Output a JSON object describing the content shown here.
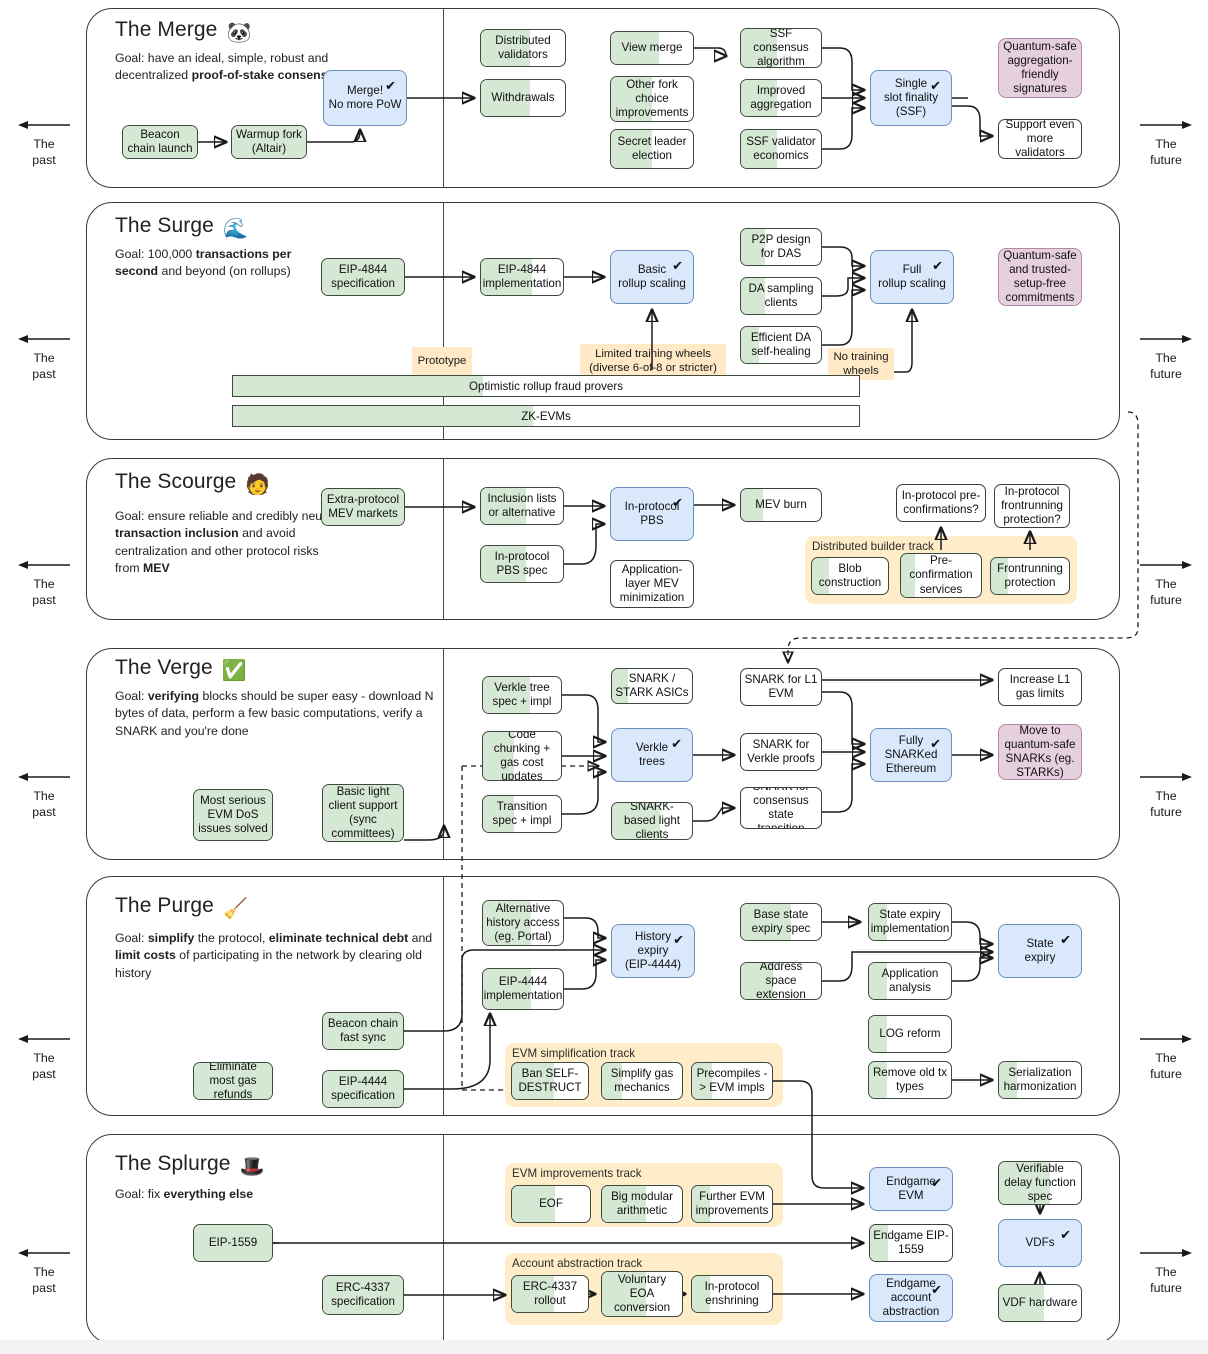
{
  "timeline": {
    "past_label": "The\npast",
    "past_line1": "The",
    "past_line2": "past",
    "future_line1": "The",
    "future_line2": "future"
  },
  "sections": [
    {
      "id": "merge",
      "title": "The Merge",
      "emoji": "🐼",
      "goal_html": "Goal: have an ideal, simple, robust and decentralized <b>proof-of-stake consensus</b>",
      "nodes": [
        {
          "name": "beacon-chain-launch",
          "label": "Beacon chain launch",
          "style": "green",
          "fill": 100
        },
        {
          "name": "warmup-fork-altair",
          "label": "Warmup fork (Altair)",
          "style": "green",
          "fill": 100
        },
        {
          "name": "merge-no-more-pow",
          "label": "Merge! ✔\nNo more PoW",
          "style": "blue",
          "fill": 0,
          "check": true
        },
        {
          "name": "distributed-validators",
          "label": "Distributed validators",
          "style": "green",
          "fill": 58
        },
        {
          "name": "withdrawals",
          "label": "Withdrawals",
          "style": "green",
          "fill": 58
        },
        {
          "name": "view-merge",
          "label": "View merge",
          "style": "green",
          "fill": 58
        },
        {
          "name": "other-fork-choice-improvements",
          "label": "Other fork choice improvements",
          "style": "green",
          "fill": 50
        },
        {
          "name": "secret-leader-election",
          "label": "Secret leader election",
          "style": "green",
          "fill": 50
        },
        {
          "name": "ssf-consensus-algorithm",
          "label": "SSF consensus algorithm",
          "style": "green",
          "fill": 45
        },
        {
          "name": "improved-aggregation",
          "label": "Improved aggregation",
          "style": "green",
          "fill": 45
        },
        {
          "name": "ssf-validator-economics",
          "label": "SSF validator economics",
          "style": "green",
          "fill": 45
        },
        {
          "name": "single-slot-finality",
          "label": "Single ✔\nslot finality\n(SSF)",
          "style": "blue",
          "fill": 0,
          "check": true
        },
        {
          "name": "quantum-safe-aggregation-friendly-signatures",
          "label": "Quantum-safe aggregation-friendly signatures",
          "style": "purple",
          "fill": 0
        },
        {
          "name": "support-even-more-validators",
          "label": "Support even more validators",
          "style": "plain",
          "fill": 0
        }
      ]
    },
    {
      "id": "surge",
      "title": "The Surge",
      "emoji": "🌊",
      "goal_html": "Goal: 100,000 <b>transactions per second</b> and beyond (on rollups)",
      "nodes": [
        {
          "name": "eip-4844-specification",
          "label": "EIP-4844 specification",
          "style": "green",
          "fill": 100
        },
        {
          "name": "eip-4844-implementation",
          "label": "EIP-4844 implementation",
          "style": "green",
          "fill": 62
        },
        {
          "name": "basic-rollup-scaling",
          "label": "Basic ✔\nrollup scaling",
          "style": "blue",
          "fill": 0,
          "check": true
        },
        {
          "name": "p2p-design-for-das",
          "label": "P2P design for DAS",
          "style": "green",
          "fill": 30
        },
        {
          "name": "da-sampling-clients",
          "label": "DA sampling clients",
          "style": "green",
          "fill": 30
        },
        {
          "name": "efficient-da-self-healing",
          "label": "Efficient DA self-healing",
          "style": "green",
          "fill": 22
        },
        {
          "name": "full-rollup-scaling",
          "label": "Full ✔\nrollup scaling",
          "style": "blue",
          "fill": 0,
          "check": true
        },
        {
          "name": "quantum-safe-trusted-setup-free-commitments",
          "label": "Quantum-safe and trusted-setup-free commitments",
          "style": "purple",
          "fill": 0
        }
      ],
      "milestones": [
        {
          "name": "milestone-prototype",
          "label": "Prototype"
        },
        {
          "name": "milestone-limited-training-wheels",
          "label": "Limited training wheels (diverse 6-of-8 or stricter)"
        },
        {
          "name": "milestone-no-training-wheels",
          "label": "No training wheels"
        }
      ],
      "bars": [
        {
          "name": "bar-optimistic-rollup-fraud-provers",
          "label": "Optimistic rollup fraud provers",
          "fill": 40
        },
        {
          "name": "bar-zk-evms",
          "label": "ZK-EVMs",
          "fill": 48
        }
      ]
    },
    {
      "id": "scourge",
      "title": "The Scourge",
      "emoji": "🧑",
      "goal_html": "Goal: ensure reliable and credibly neutral <b>transaction inclusion</b> and avoid centralization and other protocol risks from <b>MEV</b>",
      "nodes": [
        {
          "name": "extra-protocol-mev-markets",
          "label": "Extra-protocol MEV markets",
          "style": "green",
          "fill": 100
        },
        {
          "name": "inclusion-lists-or-alternative",
          "label": "Inclusion lists or alternative",
          "style": "green",
          "fill": 55
        },
        {
          "name": "in-protocol-pbs-spec",
          "label": "In-protocol PBS spec",
          "style": "green",
          "fill": 55
        },
        {
          "name": "in-protocol-pbs",
          "label": "In-protocol ✔\nPBS",
          "style": "blue",
          "fill": 0,
          "check": true
        },
        {
          "name": "application-layer-mev-minimization",
          "label": "Application-layer MEV minimization",
          "style": "plain",
          "fill": 0
        },
        {
          "name": "mev-burn",
          "label": "MEV burn",
          "style": "plain",
          "fill": 28
        },
        {
          "name": "in-protocol-pre-confirmations",
          "label": "In-protocol pre-confirmations?",
          "style": "plain",
          "fill": 0
        },
        {
          "name": "in-protocol-frontrunning-protection",
          "label": "In-protocol frontrunning protection?",
          "style": "plain",
          "fill": 0
        },
        {
          "name": "blob-construction",
          "label": "Blob construction",
          "style": "green",
          "fill": 22
        },
        {
          "name": "pre-confirmation-services",
          "label": "Pre-confirmation services",
          "style": "green",
          "fill": 18
        },
        {
          "name": "frontrunning-protection",
          "label": "Frontrunning protection",
          "style": "green",
          "fill": 22
        }
      ],
      "tracks": [
        {
          "name": "distributed-builder-track",
          "label": "Distributed builder track"
        }
      ]
    },
    {
      "id": "verge",
      "title": "The Verge",
      "emoji": "✅",
      "goal_html": "Goal: <b>verifying</b> blocks should be super easy - download N bytes of data, perform a few basic computations, verify a SNARK and you're done",
      "nodes": [
        {
          "name": "most-serious-evm-dos-issues-solved",
          "label": "Most serious EVM DoS issues solved",
          "style": "green",
          "fill": 100
        },
        {
          "name": "basic-light-client-support",
          "label": "Basic light client support (sync committees)",
          "style": "green",
          "fill": 100
        },
        {
          "name": "verkle-tree-spec-impl",
          "label": "Verkle tree spec + impl",
          "style": "green",
          "fill": 60
        },
        {
          "name": "code-chunking-gas-cost-updates",
          "label": "Code chunking + gas cost updates",
          "style": "green",
          "fill": 40
        },
        {
          "name": "transition-spec-impl",
          "label": "Transition spec + impl",
          "style": "green",
          "fill": 40
        },
        {
          "name": "snark-stark-asics",
          "label": "SNARK / STARK ASICs",
          "style": "green",
          "fill": 20
        },
        {
          "name": "verkle-trees",
          "label": "Verkle ✔\ntrees",
          "style": "blue",
          "fill": 0,
          "check": true
        },
        {
          "name": "snark-based-light-clients",
          "label": "SNARK-based light clients",
          "style": "green",
          "fill": 60
        },
        {
          "name": "snark-for-l1-evm",
          "label": "SNARK for L1 EVM",
          "style": "plain",
          "fill": 0
        },
        {
          "name": "snark-for-verkle-proofs",
          "label": "SNARK for Verkle proofs",
          "style": "plain",
          "fill": 0
        },
        {
          "name": "snark-for-consensus-state-transition",
          "label": "SNARK for consensus state transition",
          "style": "plain",
          "fill": 0
        },
        {
          "name": "fully-snarked-ethereum",
          "label": "Fully ✔\nSNARKed Ethereum",
          "style": "blue",
          "fill": 0,
          "check": true
        },
        {
          "name": "increase-l1-gas-limits",
          "label": "Increase L1 gas limits",
          "style": "plain",
          "fill": 0
        },
        {
          "name": "move-to-quantum-safe-snarks",
          "label": "Move to quantum-safe SNARKs (eg. STARKs)",
          "style": "purple",
          "fill": 0
        }
      ]
    },
    {
      "id": "purge",
      "title": "The Purge",
      "emoji": "🧹",
      "goal_html": "Goal: <b>simplify</b> the protocol, <b>eliminate technical debt</b> and <b>limit costs</b> of participating in the network by clearing old history",
      "nodes": [
        {
          "name": "eliminate-most-gas-refunds",
          "label": "Eliminate most gas refunds",
          "style": "green",
          "fill": 100
        },
        {
          "name": "beacon-chain-fast-sync",
          "label": "Beacon chain fast sync",
          "style": "green",
          "fill": 100
        },
        {
          "name": "eip-4444-specification",
          "label": "EIP-4444 specification",
          "style": "green",
          "fill": 100
        },
        {
          "name": "alternative-history-access",
          "label": "Alternative history access (eg. Portal)",
          "style": "green",
          "fill": 60
        },
        {
          "name": "eip-4444-implementation",
          "label": "EIP-4444 implementation",
          "style": "green",
          "fill": 60
        },
        {
          "name": "history-expiry",
          "label": "History ✔\nexpiry\n(EIP-4444)",
          "style": "blue",
          "fill": 0,
          "check": true
        },
        {
          "name": "base-state-expiry-spec",
          "label": "Base state expiry spec",
          "style": "green",
          "fill": 62
        },
        {
          "name": "address-space-extension",
          "label": "Address space extension",
          "style": "green",
          "fill": 40
        },
        {
          "name": "state-expiry-implementation",
          "label": "State expiry implementation",
          "style": "green",
          "fill": 22
        },
        {
          "name": "application-analysis",
          "label": "Application analysis",
          "style": "green",
          "fill": 22
        },
        {
          "name": "log-reform",
          "label": "LOG reform",
          "style": "green",
          "fill": 22
        },
        {
          "name": "remove-old-tx-types",
          "label": "Remove old tx types",
          "style": "green",
          "fill": 22
        },
        {
          "name": "state-expiry",
          "label": "State ✔\nexpiry",
          "style": "blue",
          "fill": 0,
          "check": true
        },
        {
          "name": "serialization-harmonization",
          "label": "Serialization harmonization",
          "style": "green",
          "fill": 22
        },
        {
          "name": "ban-self-destruct",
          "label": "Ban SELF-DESTRUCT",
          "style": "green",
          "fill": 55
        },
        {
          "name": "simplify-gas-mechanics",
          "label": "Simplify gas mechanics",
          "style": "green",
          "fill": 25
        },
        {
          "name": "precompiles-to-evm-impls",
          "label": "Precompiles -> EVM impls",
          "style": "green",
          "fill": 25
        }
      ],
      "tracks": [
        {
          "name": "evm-simplification-track",
          "label": "EVM simplification track"
        }
      ]
    },
    {
      "id": "splurge",
      "title": "The Splurge",
      "emoji": "🎩",
      "goal_html": "Goal: fix <b>everything else</b>",
      "nodes": [
        {
          "name": "eip-1559",
          "label": "EIP-1559",
          "style": "green",
          "fill": 100
        },
        {
          "name": "erc-4337-specification",
          "label": "ERC-4337 specification",
          "style": "green",
          "fill": 100
        },
        {
          "name": "eof",
          "label": "EOF",
          "style": "green",
          "fill": 55
        },
        {
          "name": "big-modular-arithmetic",
          "label": "Big modular arithmetic",
          "style": "green",
          "fill": 55
        },
        {
          "name": "further-evm-improvements",
          "label": "Further EVM improvements",
          "style": "green",
          "fill": 22
        },
        {
          "name": "erc-4337-rollout",
          "label": "ERC-4337 rollout",
          "style": "green",
          "fill": 55
        },
        {
          "name": "voluntary-eoa-conversion",
          "label": "Voluntary EOA conversion",
          "style": "green",
          "fill": 55
        },
        {
          "name": "in-protocol-enshrining",
          "label": "In-protocol enshrining",
          "style": "green",
          "fill": 22
        },
        {
          "name": "endgame-evm",
          "label": "Endgame✔\nEVM",
          "style": "blue",
          "fill": 0,
          "check": true
        },
        {
          "name": "endgame-eip-1559",
          "label": "Endgame EIP-1559",
          "style": "plain",
          "fill": 22
        },
        {
          "name": "endgame-account-abstraction",
          "label": "Endgame ✔\naccount abstraction",
          "style": "blue",
          "fill": 0,
          "check": true
        },
        {
          "name": "verifiable-delay-function-spec",
          "label": "Verifiable delay function spec",
          "style": "green",
          "fill": 62
        },
        {
          "name": "vdfs",
          "label": "VDFs ✔",
          "style": "blue",
          "fill": 0,
          "check": true
        },
        {
          "name": "vdf-hardware",
          "label": "VDF hardware",
          "style": "green",
          "fill": 55
        }
      ],
      "tracks": [
        {
          "name": "evm-improvements-track",
          "label": "EVM improvements track"
        },
        {
          "name": "account-abstraction-track",
          "label": "Account abstraction track"
        }
      ]
    }
  ],
  "colors": {
    "green_fill": "#d5e8d4",
    "blue": "#dae8fc",
    "purple": "#e6d0de",
    "peach": "#ffeacb",
    "border": "#3d4a3d"
  }
}
